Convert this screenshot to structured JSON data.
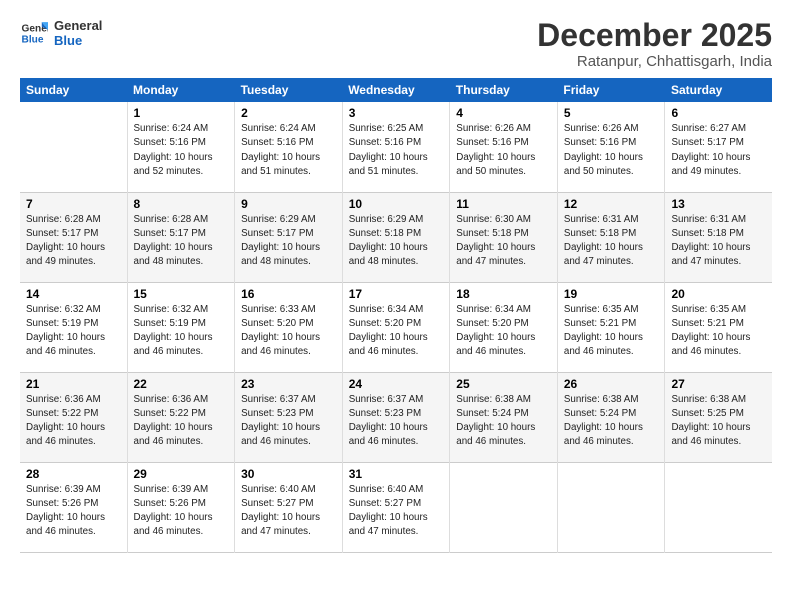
{
  "logo": {
    "line1": "General",
    "line2": "Blue"
  },
  "title": "December 2025",
  "location": "Ratanpur, Chhattisgarh, India",
  "weekdays": [
    "Sunday",
    "Monday",
    "Tuesday",
    "Wednesday",
    "Thursday",
    "Friday",
    "Saturday"
  ],
  "weeks": [
    [
      {
        "day": "",
        "info": ""
      },
      {
        "day": "1",
        "info": "Sunrise: 6:24 AM\nSunset: 5:16 PM\nDaylight: 10 hours\nand 52 minutes."
      },
      {
        "day": "2",
        "info": "Sunrise: 6:24 AM\nSunset: 5:16 PM\nDaylight: 10 hours\nand 51 minutes."
      },
      {
        "day": "3",
        "info": "Sunrise: 6:25 AM\nSunset: 5:16 PM\nDaylight: 10 hours\nand 51 minutes."
      },
      {
        "day": "4",
        "info": "Sunrise: 6:26 AM\nSunset: 5:16 PM\nDaylight: 10 hours\nand 50 minutes."
      },
      {
        "day": "5",
        "info": "Sunrise: 6:26 AM\nSunset: 5:16 PM\nDaylight: 10 hours\nand 50 minutes."
      },
      {
        "day": "6",
        "info": "Sunrise: 6:27 AM\nSunset: 5:17 PM\nDaylight: 10 hours\nand 49 minutes."
      }
    ],
    [
      {
        "day": "7",
        "info": "Sunrise: 6:28 AM\nSunset: 5:17 PM\nDaylight: 10 hours\nand 49 minutes."
      },
      {
        "day": "8",
        "info": "Sunrise: 6:28 AM\nSunset: 5:17 PM\nDaylight: 10 hours\nand 48 minutes."
      },
      {
        "day": "9",
        "info": "Sunrise: 6:29 AM\nSunset: 5:17 PM\nDaylight: 10 hours\nand 48 minutes."
      },
      {
        "day": "10",
        "info": "Sunrise: 6:29 AM\nSunset: 5:18 PM\nDaylight: 10 hours\nand 48 minutes."
      },
      {
        "day": "11",
        "info": "Sunrise: 6:30 AM\nSunset: 5:18 PM\nDaylight: 10 hours\nand 47 minutes."
      },
      {
        "day": "12",
        "info": "Sunrise: 6:31 AM\nSunset: 5:18 PM\nDaylight: 10 hours\nand 47 minutes."
      },
      {
        "day": "13",
        "info": "Sunrise: 6:31 AM\nSunset: 5:18 PM\nDaylight: 10 hours\nand 47 minutes."
      }
    ],
    [
      {
        "day": "14",
        "info": "Sunrise: 6:32 AM\nSunset: 5:19 PM\nDaylight: 10 hours\nand 46 minutes."
      },
      {
        "day": "15",
        "info": "Sunrise: 6:32 AM\nSunset: 5:19 PM\nDaylight: 10 hours\nand 46 minutes."
      },
      {
        "day": "16",
        "info": "Sunrise: 6:33 AM\nSunset: 5:20 PM\nDaylight: 10 hours\nand 46 minutes."
      },
      {
        "day": "17",
        "info": "Sunrise: 6:34 AM\nSunset: 5:20 PM\nDaylight: 10 hours\nand 46 minutes."
      },
      {
        "day": "18",
        "info": "Sunrise: 6:34 AM\nSunset: 5:20 PM\nDaylight: 10 hours\nand 46 minutes."
      },
      {
        "day": "19",
        "info": "Sunrise: 6:35 AM\nSunset: 5:21 PM\nDaylight: 10 hours\nand 46 minutes."
      },
      {
        "day": "20",
        "info": "Sunrise: 6:35 AM\nSunset: 5:21 PM\nDaylight: 10 hours\nand 46 minutes."
      }
    ],
    [
      {
        "day": "21",
        "info": "Sunrise: 6:36 AM\nSunset: 5:22 PM\nDaylight: 10 hours\nand 46 minutes."
      },
      {
        "day": "22",
        "info": "Sunrise: 6:36 AM\nSunset: 5:22 PM\nDaylight: 10 hours\nand 46 minutes."
      },
      {
        "day": "23",
        "info": "Sunrise: 6:37 AM\nSunset: 5:23 PM\nDaylight: 10 hours\nand 46 minutes."
      },
      {
        "day": "24",
        "info": "Sunrise: 6:37 AM\nSunset: 5:23 PM\nDaylight: 10 hours\nand 46 minutes."
      },
      {
        "day": "25",
        "info": "Sunrise: 6:38 AM\nSunset: 5:24 PM\nDaylight: 10 hours\nand 46 minutes."
      },
      {
        "day": "26",
        "info": "Sunrise: 6:38 AM\nSunset: 5:24 PM\nDaylight: 10 hours\nand 46 minutes."
      },
      {
        "day": "27",
        "info": "Sunrise: 6:38 AM\nSunset: 5:25 PM\nDaylight: 10 hours\nand 46 minutes."
      }
    ],
    [
      {
        "day": "28",
        "info": "Sunrise: 6:39 AM\nSunset: 5:26 PM\nDaylight: 10 hours\nand 46 minutes."
      },
      {
        "day": "29",
        "info": "Sunrise: 6:39 AM\nSunset: 5:26 PM\nDaylight: 10 hours\nand 46 minutes."
      },
      {
        "day": "30",
        "info": "Sunrise: 6:40 AM\nSunset: 5:27 PM\nDaylight: 10 hours\nand 47 minutes."
      },
      {
        "day": "31",
        "info": "Sunrise: 6:40 AM\nSunset: 5:27 PM\nDaylight: 10 hours\nand 47 minutes."
      },
      {
        "day": "",
        "info": ""
      },
      {
        "day": "",
        "info": ""
      },
      {
        "day": "",
        "info": ""
      }
    ]
  ]
}
